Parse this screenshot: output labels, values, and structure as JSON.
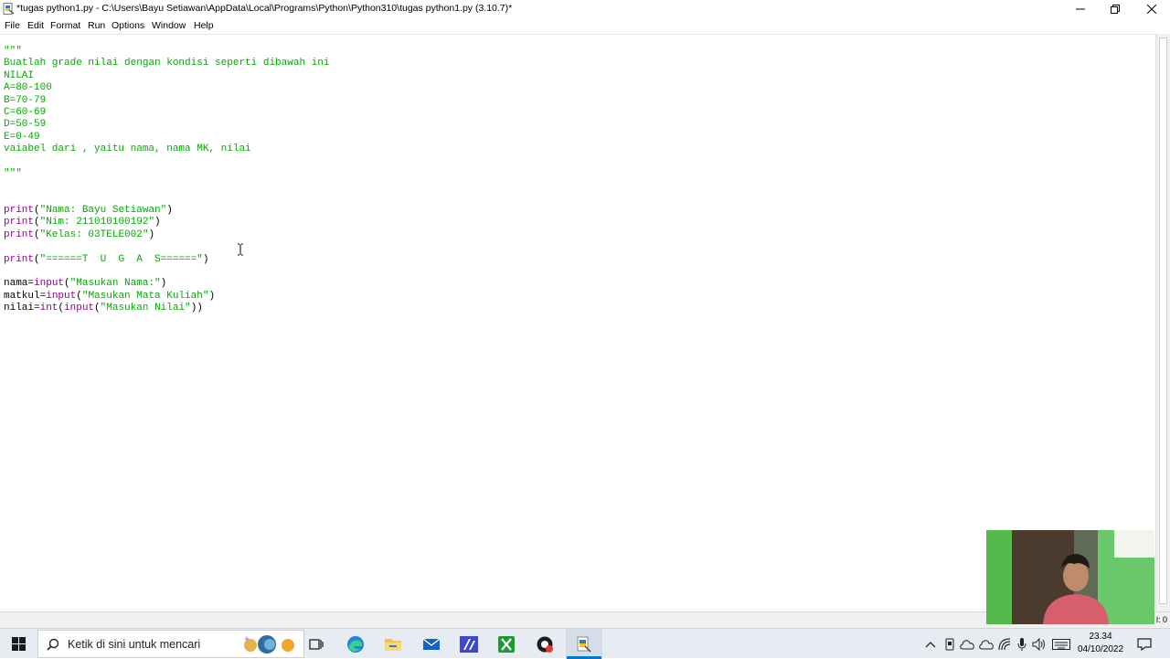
{
  "window": {
    "title": "*tugas python1.py - C:\\Users\\Bayu Setiawan\\AppData\\Local\\Programs\\Python\\Python310\\tugas python1.py (3.10.7)*"
  },
  "menu": [
    "File",
    "Edit",
    "Format",
    "Run",
    "Options",
    "Window",
    "Help"
  ],
  "editor": {
    "lines": [
      {
        "parts": [
          {
            "t": "\"\"\"",
            "c": "str"
          }
        ]
      },
      {
        "parts": [
          {
            "t": "Buatlah grade nilai dengan kondisi seperti dibawah ini",
            "c": "str"
          }
        ]
      },
      {
        "parts": [
          {
            "t": "NILAI",
            "c": "str"
          }
        ]
      },
      {
        "parts": [
          {
            "t": "A=80-100",
            "c": "str"
          }
        ]
      },
      {
        "parts": [
          {
            "t": "B=70-79",
            "c": "str"
          }
        ]
      },
      {
        "parts": [
          {
            "t": "C=60-69",
            "c": "str"
          }
        ]
      },
      {
        "parts": [
          {
            "t": "D=50-59",
            "c": "str"
          }
        ]
      },
      {
        "parts": [
          {
            "t": "E=0-49",
            "c": "str"
          }
        ]
      },
      {
        "parts": [
          {
            "t": "vaiabel dari , yaitu nama, nama MK, nilai",
            "c": "str"
          }
        ]
      },
      {
        "parts": []
      },
      {
        "parts": [
          {
            "t": "\"\"\"",
            "c": "str"
          }
        ]
      },
      {
        "parts": []
      },
      {
        "parts": []
      },
      {
        "parts": [
          {
            "t": "print",
            "c": "kw"
          },
          {
            "t": "(",
            "c": ""
          },
          {
            "t": "\"Nama: Bayu Setiawan\"",
            "c": "str"
          },
          {
            "t": ")",
            "c": ""
          }
        ]
      },
      {
        "parts": [
          {
            "t": "print",
            "c": "kw"
          },
          {
            "t": "(",
            "c": ""
          },
          {
            "t": "\"Nim: 211010100192\"",
            "c": "str"
          },
          {
            "t": ")",
            "c": ""
          }
        ]
      },
      {
        "parts": [
          {
            "t": "print",
            "c": "kw"
          },
          {
            "t": "(",
            "c": ""
          },
          {
            "t": "\"Kelas: 03TELE002\"",
            "c": "str"
          },
          {
            "t": ")",
            "c": ""
          }
        ]
      },
      {
        "parts": []
      },
      {
        "parts": [
          {
            "t": "print",
            "c": "kw"
          },
          {
            "t": "(",
            "c": ""
          },
          {
            "t": "\"======T  U  G  A  S======\"",
            "c": "str"
          },
          {
            "t": ")",
            "c": ""
          }
        ]
      },
      {
        "parts": []
      },
      {
        "parts": [
          {
            "t": "nama=",
            "c": ""
          },
          {
            "t": "input",
            "c": "kw"
          },
          {
            "t": "(",
            "c": ""
          },
          {
            "t": "\"Masukan Nama:\"",
            "c": "str"
          },
          {
            "t": ")",
            "c": ""
          }
        ]
      },
      {
        "parts": [
          {
            "t": "matkul=",
            "c": ""
          },
          {
            "t": "input",
            "c": "kw"
          },
          {
            "t": "(",
            "c": ""
          },
          {
            "t": "\"Masukan Mata Kuliah\"",
            "c": "str"
          },
          {
            "t": ")",
            "c": ""
          }
        ]
      },
      {
        "parts": [
          {
            "t": "nilai=",
            "c": ""
          },
          {
            "t": "int",
            "c": "kw"
          },
          {
            "t": "(",
            "c": ""
          },
          {
            "t": "input",
            "c": "kw"
          },
          {
            "t": "(",
            "c": ""
          },
          {
            "t": "\"Masukan Nilai\"",
            "c": "str"
          },
          {
            "t": "))",
            "c": ""
          }
        ]
      }
    ]
  },
  "statusbar": {
    "text": "l: 0"
  },
  "taskbar": {
    "search_placeholder": "Ketik di sini untuk mencari",
    "clock_time": "23.34",
    "clock_date": "04/10/2022"
  },
  "icons": [
    "windows-start-icon",
    "search-icon",
    "task-view-icon",
    "edge-icon",
    "file-explorer-icon",
    "mail-icon",
    "app-icon",
    "xbox-icon",
    "record-icon",
    "python-idle-icon"
  ],
  "colors": {
    "string": "#00aa00",
    "keyword": "#900090",
    "accent": "#0078d4"
  }
}
